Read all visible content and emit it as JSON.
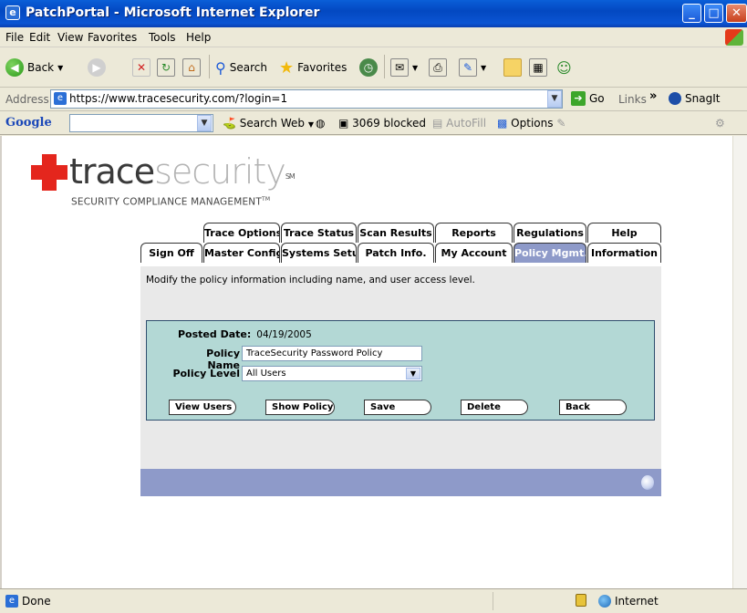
{
  "window": {
    "title": "PatchPortal - Microsoft Internet Explorer",
    "min": "_",
    "max": "□",
    "close": "✕"
  },
  "menu": [
    "File",
    "Edit",
    "View",
    "Favorites",
    "Tools",
    "Help"
  ],
  "toolbar": {
    "back": "Back",
    "search": "Search",
    "favorites": "Favorites"
  },
  "address": {
    "label": "Address",
    "url": "https://www.tracesecurity.com/?login=1",
    "go": "Go",
    "links": "Links",
    "snagit": "SnagIt"
  },
  "google": {
    "logo": "Google",
    "search_web": "Search Web",
    "blocked": "3069 blocked",
    "autofill": "AutoFill",
    "options": "Options"
  },
  "brand": {
    "word_dark": "trace",
    "word_light": "security",
    "sm": "SM",
    "tagline": "SECURITY COMPLIANCE MANAGEMENT",
    "tm": "TM"
  },
  "tabs_top": [
    "Trace Options",
    "Trace Status",
    "Scan Results",
    "Reports",
    "Regulations",
    "Help"
  ],
  "tabs_bottom": [
    "Sign Off",
    "Master Config",
    "Systems Setup",
    "Patch Info.",
    "My Account",
    "Policy Mgmt.",
    "Information"
  ],
  "active_tab": "Policy Mgmt.",
  "page": {
    "description": "Modify the policy information including name, and user access level.",
    "posted_date_label": "Posted Date:",
    "posted_date": "04/19/2005",
    "policy_name_label": "Policy Name",
    "policy_name": "TraceSecurity Password Policy",
    "policy_level_label": "Policy Level",
    "policy_level": "All Users"
  },
  "buttons": [
    "View Users",
    "Show Policy",
    "Save",
    "Delete",
    "Back"
  ],
  "status": {
    "text": "Done",
    "zone": "Internet"
  },
  "colors": {
    "accent": "#8e9ac9",
    "form_bg": "#b3d8d5",
    "brand_red": "#e4261d"
  }
}
